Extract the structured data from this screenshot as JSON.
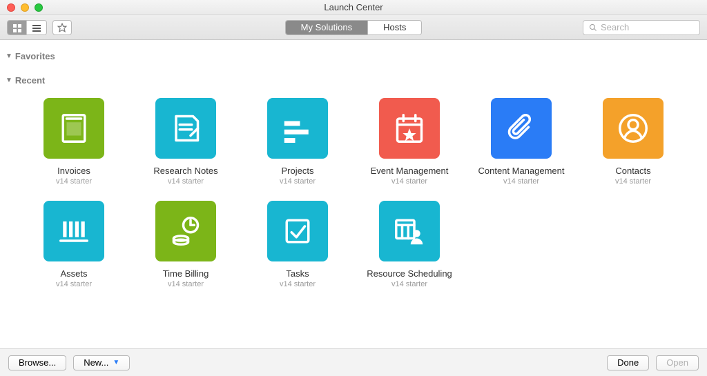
{
  "window": {
    "title": "Launch Center"
  },
  "toolbar": {
    "tabs": {
      "my_solutions": "My Solutions",
      "hosts": "Hosts",
      "active": "my_solutions"
    },
    "search_placeholder": "Search"
  },
  "sections": {
    "favorites_label": "Favorites",
    "recent_label": "Recent"
  },
  "tiles": [
    {
      "id": "invoices",
      "label": "Invoices",
      "sub": "v14 starter",
      "color": "#7cb518",
      "icon": "invoice"
    },
    {
      "id": "research-notes",
      "label": "Research Notes",
      "sub": "v14 starter",
      "color": "#18b6d1",
      "icon": "note"
    },
    {
      "id": "projects",
      "label": "Projects",
      "sub": "v14 starter",
      "color": "#18b6d1",
      "icon": "projects"
    },
    {
      "id": "event-management",
      "label": "Event Management",
      "sub": "v14 starter",
      "color": "#f15b4e",
      "icon": "event"
    },
    {
      "id": "content-management",
      "label": "Content Management",
      "sub": "v14 starter",
      "color": "#2a7cf6",
      "icon": "clip"
    },
    {
      "id": "contacts",
      "label": "Contacts",
      "sub": "v14 starter",
      "color": "#f4a12a",
      "icon": "contact"
    },
    {
      "id": "assets",
      "label": "Assets",
      "sub": "v14 starter",
      "color": "#18b6d1",
      "icon": "assets"
    },
    {
      "id": "time-billing",
      "label": "Time Billing",
      "sub": "v14 starter",
      "color": "#7cb518",
      "icon": "time"
    },
    {
      "id": "tasks",
      "label": "Tasks",
      "sub": "v14 starter",
      "color": "#18b6d1",
      "icon": "tasks"
    },
    {
      "id": "resource-scheduling",
      "label": "Resource Scheduling",
      "sub": "v14 starter",
      "color": "#18b6d1",
      "icon": "resource"
    }
  ],
  "bottom": {
    "browse": "Browse...",
    "new": "New...",
    "done": "Done",
    "open": "Open"
  }
}
